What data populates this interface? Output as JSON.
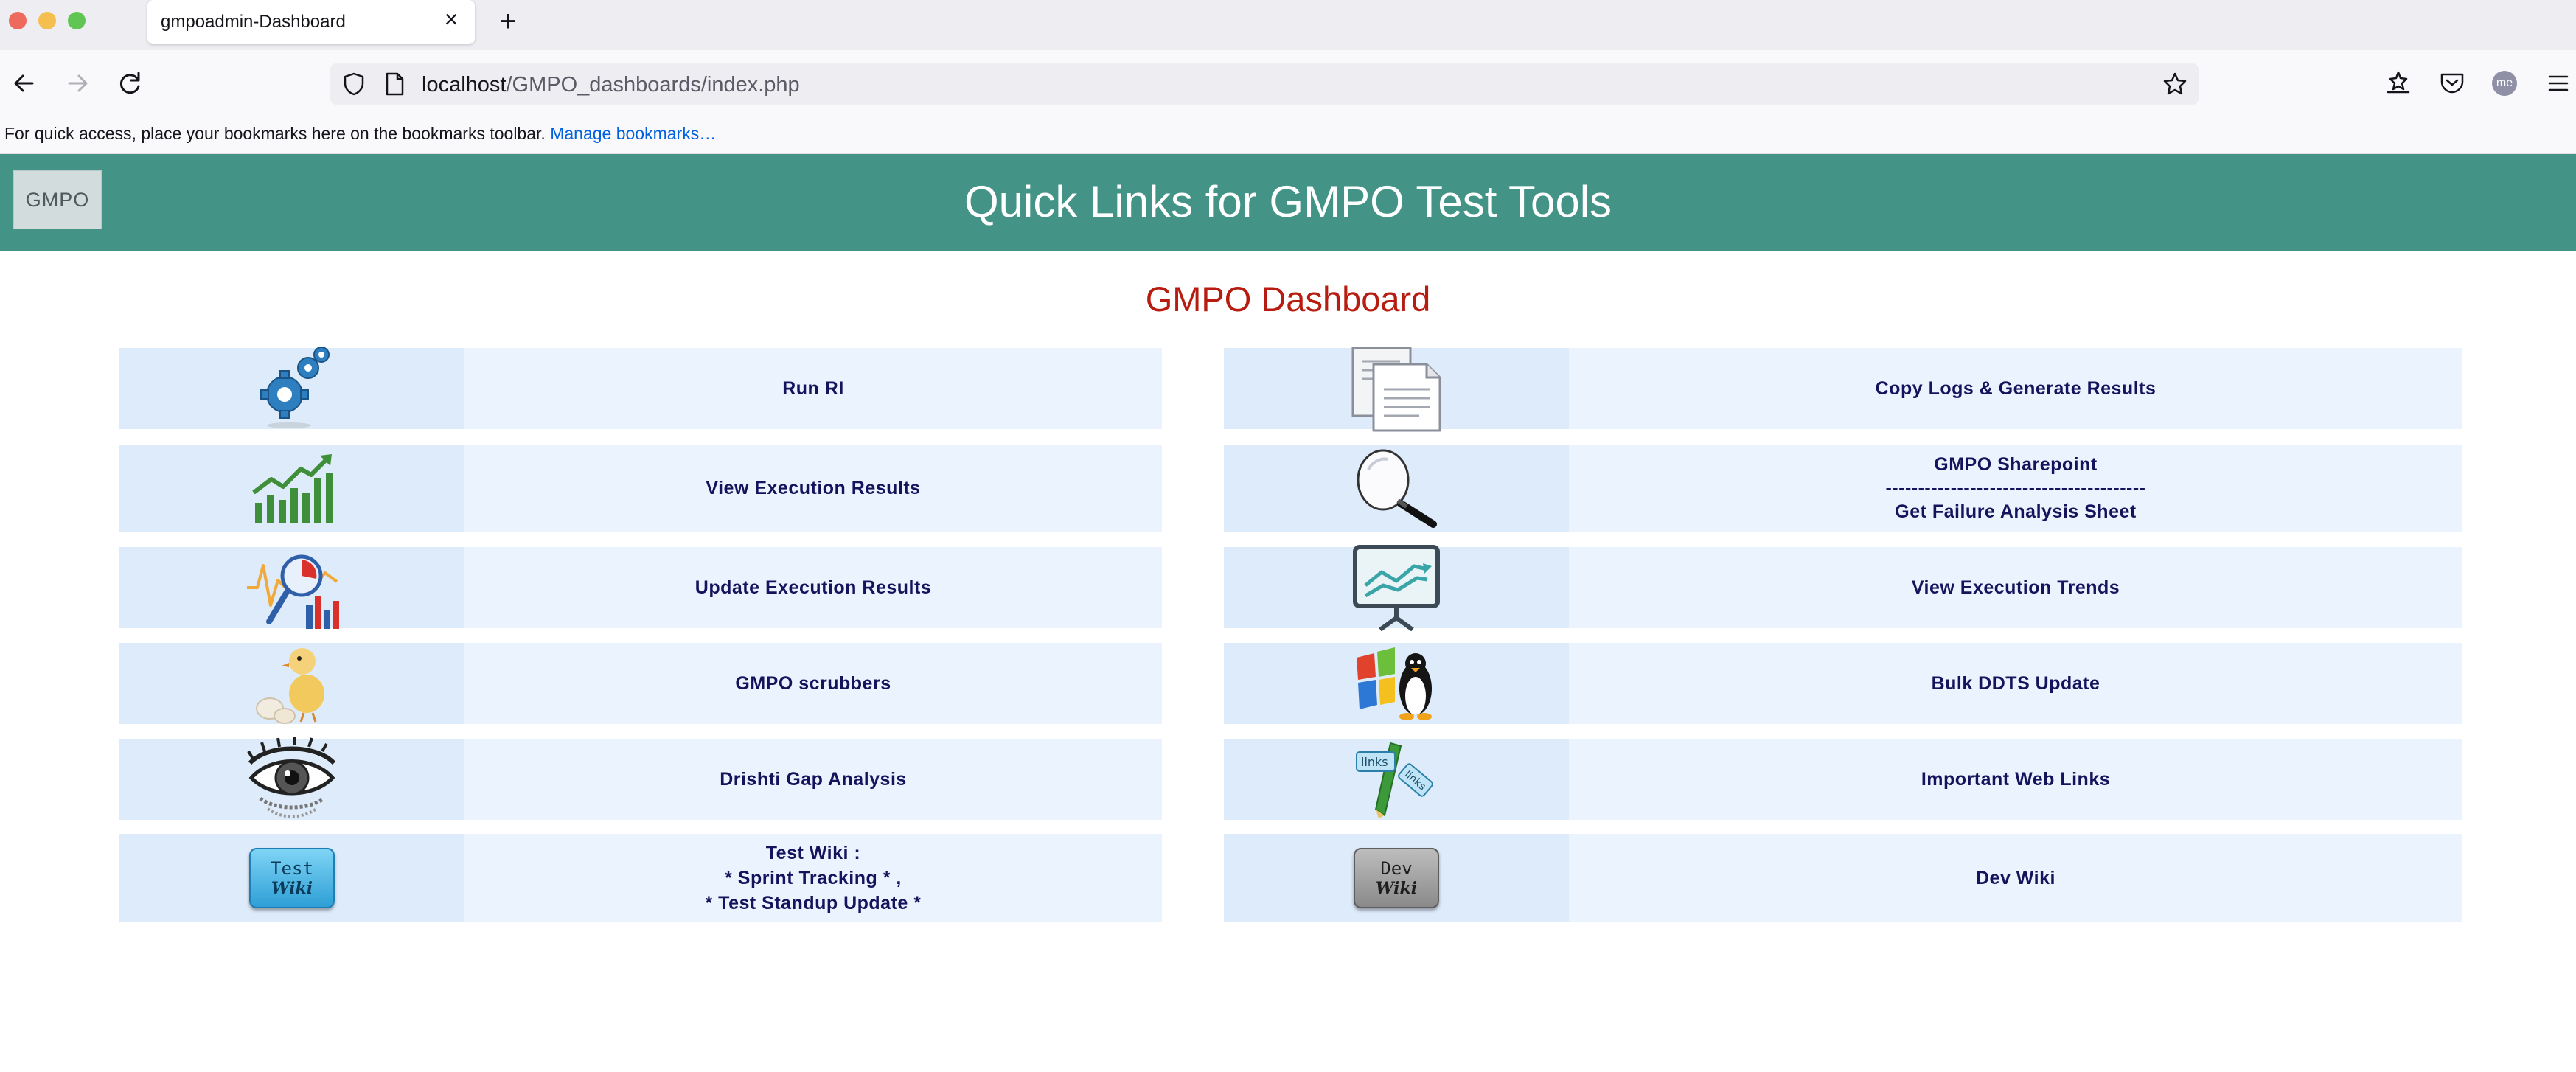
{
  "browser": {
    "tab_title": "gmpoadmin-Dashboard",
    "tab_close": "×",
    "new_tab": "+",
    "url_host": "localhost",
    "url_path": "/GMPO_dashboards/index.php",
    "avatar_initials": "me",
    "bookmarks_message": "For quick access, place your bookmarks here on the bookmarks toolbar.",
    "bookmarks_link": "Manage bookmarks…"
  },
  "header": {
    "logo_text": "GMPO",
    "title": "Quick Links for GMPO Test Tools",
    "bg_color": "#439387"
  },
  "dashboard": {
    "title": "GMPO Dashboard",
    "title_color": "#b71c10",
    "left": [
      {
        "label": "Run RI",
        "icon": "gears-icon"
      },
      {
        "label": "View Execution Results",
        "icon": "growth-chart-icon"
      },
      {
        "label": "Update Execution Results",
        "icon": "analytics-magnifier-icon"
      },
      {
        "label": "GMPO scrubbers",
        "icon": "chick-icon"
      },
      {
        "label": "Drishti Gap Analysis",
        "icon": "eye-icon"
      },
      {
        "lines": [
          "Test Wiki :",
          "* Sprint Tracking * ,",
          "* Test Standup Update *"
        ],
        "icon": "test-wiki-icon",
        "btn_top": "Test",
        "btn_bottom": "Wiki"
      }
    ],
    "right": [
      {
        "label": "Copy Logs & Generate Results",
        "icon": "documents-icon"
      },
      {
        "lines": [
          "GMPO Sharepoint",
          "----------------------------------------",
          "Get Failure Analysis Sheet"
        ],
        "icon": "magnifier-icon"
      },
      {
        "label": "View Execution Trends",
        "icon": "presentation-board-icon"
      },
      {
        "label": "Bulk DDTS Update",
        "icon": "windows-linux-icon"
      },
      {
        "label": "Important Web Links",
        "icon": "web-links-icon",
        "tag1": "links",
        "tag2": "links"
      },
      {
        "label": "Dev Wiki",
        "icon": "dev-wiki-icon",
        "btn_top": "Dev",
        "btn_bottom": "Wiki"
      }
    ]
  }
}
